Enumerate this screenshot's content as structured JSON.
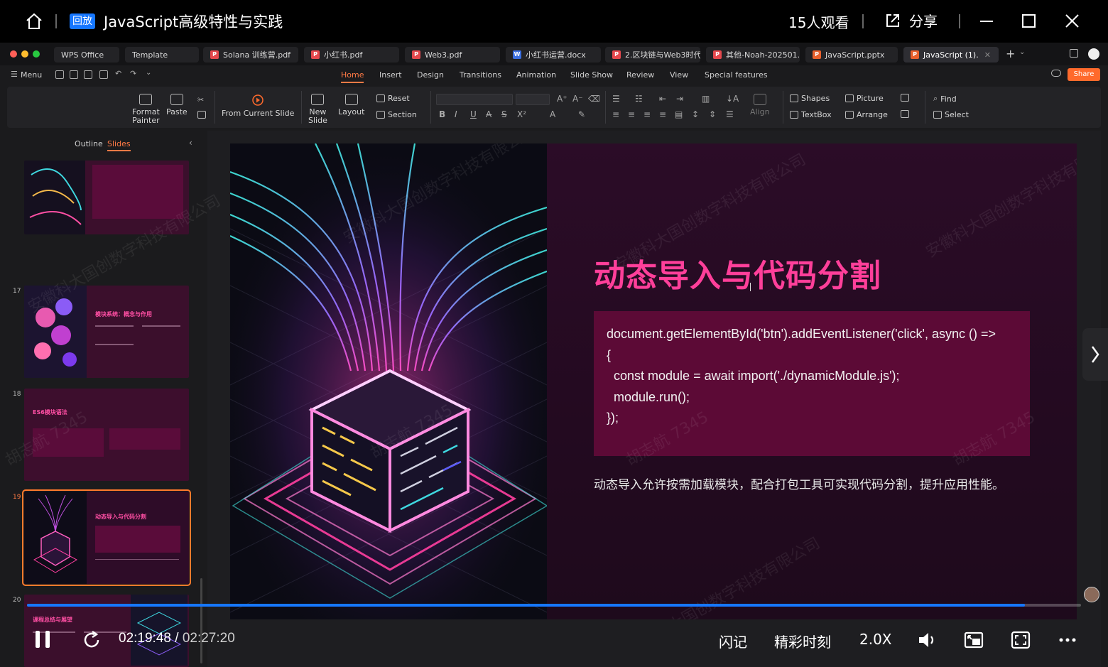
{
  "player": {
    "replay_badge": "回放",
    "title": "JavaScript高级特性与实践",
    "viewers": "15人观看",
    "share_label": "分享",
    "current_time": "02:19:48",
    "time_separator": " / ",
    "duration": "02:27:20",
    "progress_fraction": 0.947,
    "flash_note": "闪记",
    "highlights": "精彩时刻",
    "speed": "2.0X"
  },
  "wps": {
    "tabs": [
      {
        "label": "WPS Office",
        "type": "wps"
      },
      {
        "label": "Template",
        "type": "wps"
      },
      {
        "label": "Solana 训练营.pdf",
        "type": "pdf"
      },
      {
        "label": "小红书.pdf",
        "type": "pdf"
      },
      {
        "label": "Web3.pdf",
        "type": "pdf"
      },
      {
        "label": "小红书运营.docx",
        "type": "doc"
      },
      {
        "label": "2.区块链与Web3时代",
        "type": "pdf"
      },
      {
        "label": "其他-Noah-202501.p",
        "type": "pdf"
      },
      {
        "label": "JavaScript.pptx",
        "type": "ppt"
      },
      {
        "label": "JavaScript (1).",
        "type": "ppt"
      }
    ],
    "menu_label": "Menu",
    "ribbon_tabs": [
      "Home",
      "Insert",
      "Design",
      "Transitions",
      "Animation",
      "Slide Show",
      "Review",
      "View",
      "Special features"
    ],
    "share_label": "Share",
    "ribbon": {
      "format_painter": "Format\nPainter",
      "paste": "Paste",
      "from_current_slide": "From Current Slide",
      "new_slide": "New\nSlide",
      "layout": "Layout",
      "reset": "Reset",
      "section": "Section",
      "align": "Align",
      "shapes": "Shapes",
      "picture": "Picture",
      "textbox": "TextBox",
      "arrange": "Arrange",
      "find": "Find",
      "select": "Select"
    },
    "pane_tabs": {
      "outline": "Outline",
      "slides": "Slides"
    },
    "thumbnails": [
      {
        "number": "",
        "title": ""
      },
      {
        "number": "17",
        "title": "模块系统：概念与作用"
      },
      {
        "number": "18",
        "title": "ES6模块语法"
      },
      {
        "number": "19",
        "title": "动态导入与代码分割"
      },
      {
        "number": "20",
        "title": "课程总结与展望"
      }
    ]
  },
  "slide": {
    "title": "动态导入与代码分割",
    "code": "document.getElementById('btn').addEventListener('click', async () =>\n{\n  const module = await import('./dynamicModule.js');\n  module.run();\n});",
    "description": "动态导入允许按需加载模块，配合打包工具可实现代码分割，提升应用性能。"
  },
  "watermarks": [
    "安徽科大国创数字科技有限公司",
    "胡志航 7345"
  ],
  "colors": {
    "accent_orange": "#ff7a45",
    "slide_title_pink": "#ff3f9a",
    "code_box": "#5c0a36",
    "progress_blue": "#1677ff",
    "replay_badge_blue": "#1677ff"
  }
}
